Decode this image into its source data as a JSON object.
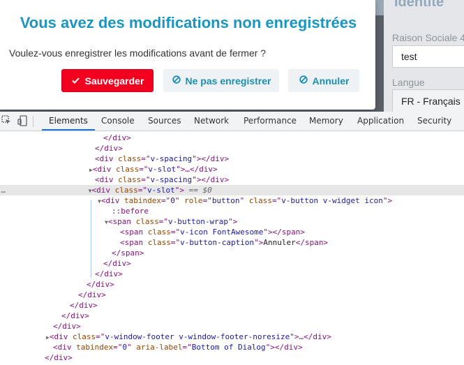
{
  "dialog": {
    "title": "Vous avez des modifications non enregistrées",
    "message": "Voulez-vous enregistrer les modifications avant de fermer ?",
    "buttons": {
      "save": {
        "label": "Sauvegarder",
        "icon": "check-icon"
      },
      "dont_save": {
        "label": "Ne pas enregistrer",
        "icon": "ban-icon"
      },
      "cancel": {
        "label": "Annuler",
        "icon": "ban-icon"
      }
    },
    "colors": {
      "title": "#1a96c0",
      "save_bg": "#f2001f",
      "secondary_text": "#1a8fb4"
    }
  },
  "app": {
    "section_title": "Identité",
    "company_name_label": "Raison Sociale 4",
    "company_name_value": "test",
    "language_label": "Langue",
    "language_value": "FR - Français"
  },
  "devtools": {
    "tabs": [
      "Elements",
      "Console",
      "Sources",
      "Network",
      "Performance",
      "Memory",
      "Application",
      "Security"
    ],
    "active_tab": "Elements",
    "tree": {
      "l1": "</div>",
      "l2": "</div>",
      "l3": {
        "open": "<div ",
        "attr": "class",
        "eq": "=\"",
        "val": "v-spacing",
        "close": "\"></div>"
      },
      "l4": {
        "open": "<div ",
        "attr": "class",
        "eq": "=\"",
        "val": "v-slot",
        "close": "\">…</div>"
      },
      "l5": {
        "open": "<div ",
        "attr": "class",
        "eq": "=\"",
        "val": "v-spacing",
        "close": "\"></div>"
      },
      "l6": {
        "open": "<div ",
        "attr": "class",
        "eq": "=\"",
        "val": "v-slot",
        "close": "\">",
        "ref": " == $0"
      },
      "l7": {
        "open": "<div ",
        "a1": "tabindex",
        "v1": "0",
        "a2": "role",
        "v2": "button",
        "a3": "class",
        "v3": "v-button v-widget icon",
        "close": "\">"
      },
      "l8": "::before",
      "l9": {
        "open": "<span ",
        "attr": "class",
        "eq": "=\"",
        "val": "v-button-wrap",
        "close": "\">"
      },
      "l10": {
        "open": "<span ",
        "attr": "class",
        "eq": "=\"",
        "val": "v-icon FontAwesome",
        "close": "\">",
        "text": "",
        "end": "</span>"
      },
      "l11": {
        "open": "<span ",
        "attr": "class",
        "eq": "=\"",
        "val": "v-button-caption",
        "close": "\">",
        "text": "Annuler",
        "end": "</span>"
      },
      "l12": "</span>",
      "l13": "</div>",
      "l14": "</div>",
      "l15": "</div>",
      "l16": "</div>",
      "l17": "</div>",
      "l18": "</div>",
      "l19": "</div>",
      "l20": {
        "open": "<div ",
        "attr": "class",
        "eq": "=\"",
        "val": "v-window-footer v-window-footer-noresize",
        "close": "\">…</div>"
      },
      "l21": {
        "open": "<div ",
        "a1": "tabindex",
        "v1": "0",
        "a2": "aria-label",
        "v2": "Bottom of Dialog",
        "close": "\"></div>"
      },
      "l22": "</div>"
    }
  }
}
